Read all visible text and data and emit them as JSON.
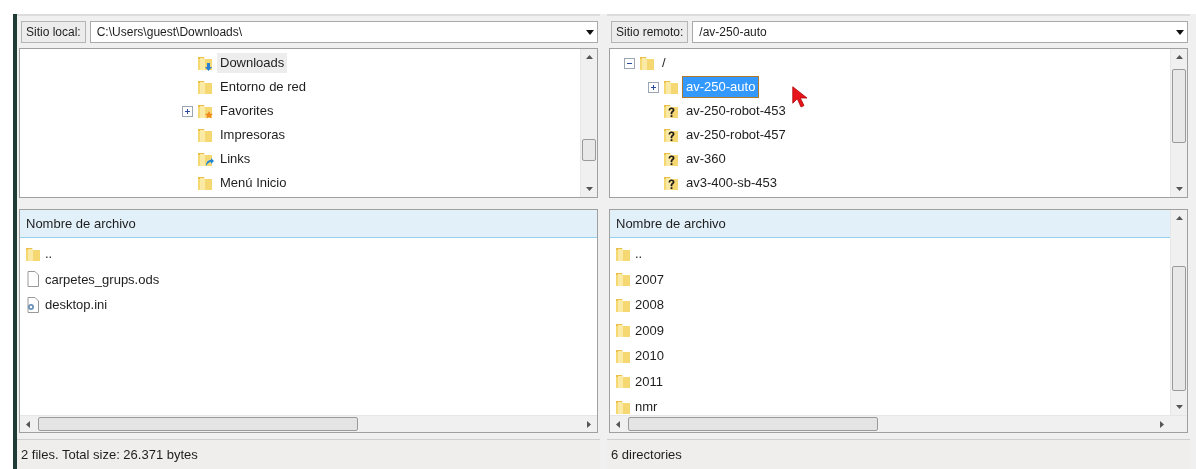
{
  "local": {
    "site_label": "Sitio local:",
    "path": "C:\\Users\\guest\\Downloads\\",
    "tree": [
      {
        "label": "Downloads",
        "kind": "download-folder",
        "selected": true
      },
      {
        "label": "Entorno de red",
        "kind": "folder",
        "selected": false
      },
      {
        "label": "Favorites",
        "kind": "star-folder",
        "expanded": false,
        "selected": false
      },
      {
        "label": "Impresoras",
        "kind": "folder",
        "selected": false
      },
      {
        "label": "Links",
        "kind": "link-folder",
        "selected": false
      },
      {
        "label": "Menú Inicio",
        "kind": "folder",
        "selected": false
      }
    ],
    "list": {
      "column": "Nombre de archivo",
      "rows": [
        {
          "name": "..",
          "kind": "folder"
        },
        {
          "name": "carpetes_grups.ods",
          "kind": "file"
        },
        {
          "name": "desktop.ini",
          "kind": "settings-file"
        }
      ]
    },
    "status": "2 files. Total size: 26.371 bytes"
  },
  "remote": {
    "site_label": "Sitio remoto:",
    "path": "/av-250-auto",
    "tree": [
      {
        "label": "/",
        "kind": "folder",
        "expanded": true,
        "selected": false,
        "children": [
          {
            "label": "av-250-auto",
            "kind": "folder",
            "expanded": false,
            "selected": true
          },
          {
            "label": "av-250-robot-453",
            "kind": "unknown-folder",
            "selected": false
          },
          {
            "label": "av-250-robot-457",
            "kind": "unknown-folder",
            "selected": false
          },
          {
            "label": "av-360",
            "kind": "unknown-folder",
            "selected": false
          },
          {
            "label": "av3-400-sb-453",
            "kind": "unknown-folder",
            "selected": false
          }
        ]
      }
    ],
    "list": {
      "column": "Nombre de archivo",
      "rows": [
        {
          "name": "..",
          "kind": "folder"
        },
        {
          "name": "2007",
          "kind": "folder"
        },
        {
          "name": "2008",
          "kind": "folder"
        },
        {
          "name": "2009",
          "kind": "folder"
        },
        {
          "name": "2010",
          "kind": "folder"
        },
        {
          "name": "2011",
          "kind": "folder"
        },
        {
          "name": "nmr",
          "kind": "folder"
        }
      ]
    },
    "status": "6 directories"
  }
}
